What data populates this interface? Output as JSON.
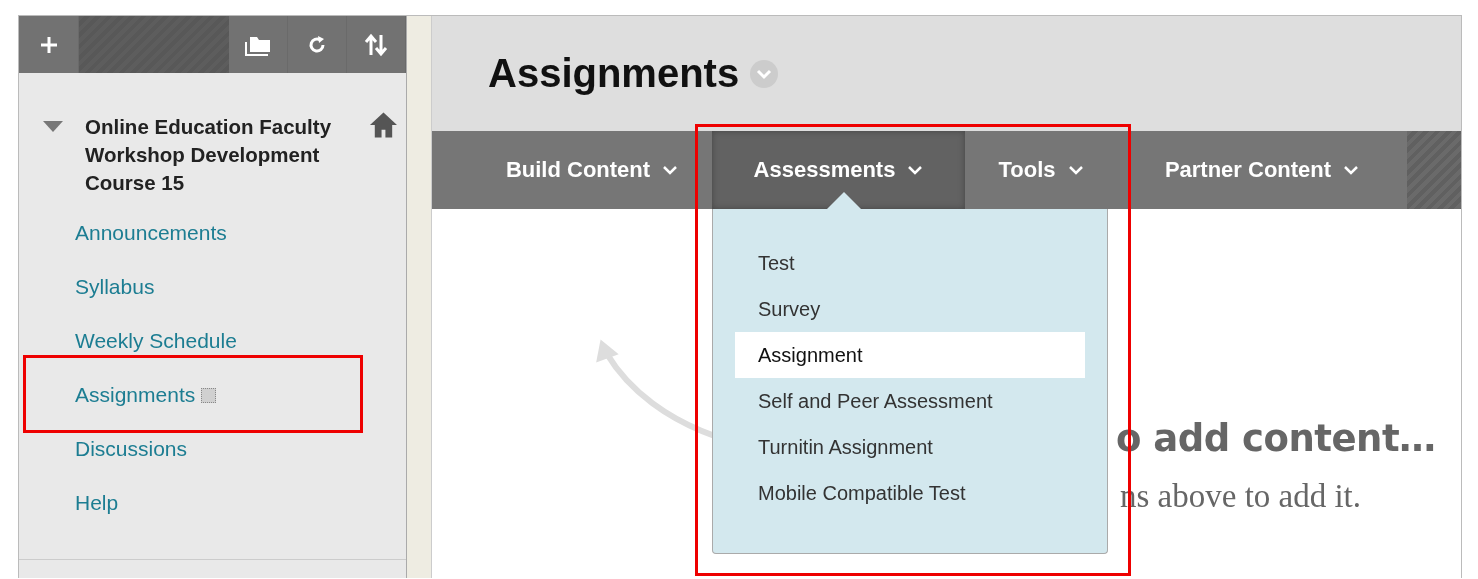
{
  "sidebar": {
    "course_title": "Online Education Faculty Workshop Development Course 15",
    "expanded": true,
    "items": [
      {
        "label": "Announcements",
        "menu_icon": false
      },
      {
        "label": "Syllabus",
        "menu_icon": false
      },
      {
        "label": "Weekly Schedule",
        "menu_icon": false
      },
      {
        "label": "Assignments",
        "menu_icon": true
      },
      {
        "label": "Discussions",
        "menu_icon": false
      },
      {
        "label": "Help",
        "menu_icon": false
      }
    ]
  },
  "page_title": "Assignments",
  "action_bar": [
    {
      "label": "Build Content",
      "selected": false
    },
    {
      "label": "Assessments",
      "selected": true
    },
    {
      "label": "Tools",
      "selected": false
    },
    {
      "label": "Partner Content",
      "selected": false
    }
  ],
  "dropdown": [
    {
      "label": "Test",
      "selected": false
    },
    {
      "label": "Survey",
      "selected": false
    },
    {
      "label": "Assignment",
      "selected": true
    },
    {
      "label": "Self and Peer Assessment",
      "selected": false
    },
    {
      "label": "Turnitin Assignment",
      "selected": false
    },
    {
      "label": "Mobile Compatible Test",
      "selected": false
    }
  ],
  "empty_state": {
    "heading": "o add content…",
    "hint": "ns above to add it."
  }
}
